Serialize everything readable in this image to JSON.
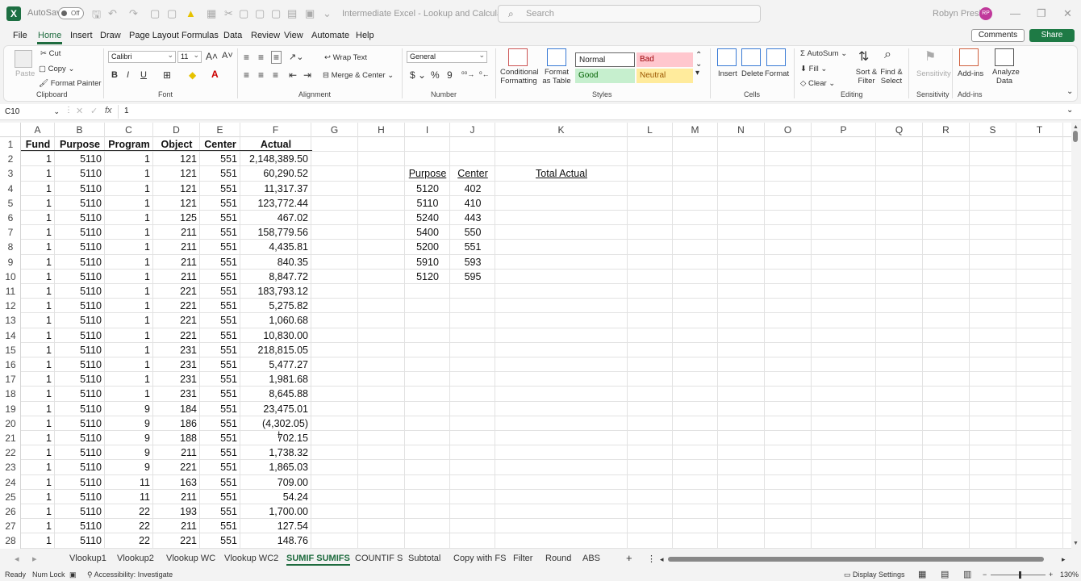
{
  "app": {
    "logo": "X",
    "autosave_label": "AutoSave",
    "autosave_state": "Off",
    "document_title": "Intermediate Excel - Lookup and Calculat...",
    "search_placeholder": "Search",
    "user_name": "Robyn Presley",
    "user_initials": "RP"
  },
  "menu": {
    "tabs": [
      "File",
      "Home",
      "Insert",
      "Draw",
      "Page Layout",
      "Formulas",
      "Data",
      "Review",
      "View",
      "Automate",
      "Help"
    ],
    "active": "Home",
    "comments_label": "Comments",
    "share_label": "Share"
  },
  "ribbon": {
    "clipboard": {
      "label": "Clipboard",
      "paste": "Paste",
      "cut": "Cut",
      "copy": "Copy",
      "format_painter": "Format Painter"
    },
    "font": {
      "label": "Font",
      "name": "Calibri",
      "size": "11",
      "bold": "B",
      "italic": "I",
      "underline": "U"
    },
    "alignment": {
      "label": "Alignment",
      "wrap_text": "Wrap Text",
      "merge_center": "Merge & Center"
    },
    "number": {
      "label": "Number",
      "format": "General",
      "currency": "$",
      "percent": "%",
      "comma": "9"
    },
    "styles": {
      "label": "Styles",
      "conditional_formatting": "Conditional Formatting",
      "format_as_table": "Format as Table",
      "normal": "Normal",
      "bad": "Bad",
      "good": "Good",
      "neutral": "Neutral"
    },
    "cells": {
      "label": "Cells",
      "insert": "Insert",
      "delete": "Delete",
      "format": "Format"
    },
    "editing": {
      "label": "Editing",
      "autosum": "AutoSum",
      "fill": "Fill",
      "clear": "Clear",
      "sort_filter": "Sort & Filter",
      "find_select": "Find & Select"
    },
    "sensitivity": {
      "label": "Sensitivity",
      "button": "Sensitivity"
    },
    "addins": {
      "label": "Add-ins",
      "button": "Add-ins",
      "analyze": "Analyze Data"
    }
  },
  "formula_bar": {
    "name_box": "C10",
    "fx": "fx",
    "value": "1"
  },
  "columns": [
    "A",
    "B",
    "C",
    "D",
    "E",
    "F",
    "G",
    "H",
    "I",
    "J",
    "K",
    "L",
    "M",
    "N",
    "O",
    "P",
    "Q",
    "R",
    "S",
    "T"
  ],
  "rows": [
    "1",
    "2",
    "3",
    "4",
    "5",
    "6",
    "7",
    "8",
    "9",
    "10",
    "11",
    "12",
    "13",
    "14",
    "15",
    "16",
    "17",
    "18",
    "19",
    "20",
    "21",
    "22",
    "23",
    "24",
    "25",
    "26",
    "27",
    "28"
  ],
  "table": {
    "headers": [
      "Fund",
      "Purpose",
      "Program",
      "Object",
      "Center",
      "Actual"
    ],
    "data": [
      [
        "1",
        "5110",
        "1",
        "121",
        "551",
        "2,148,389.50"
      ],
      [
        "1",
        "5110",
        "1",
        "121",
        "551",
        "60,290.52"
      ],
      [
        "1",
        "5110",
        "1",
        "121",
        "551",
        "11,317.37"
      ],
      [
        "1",
        "5110",
        "1",
        "121",
        "551",
        "123,772.44"
      ],
      [
        "1",
        "5110",
        "1",
        "125",
        "551",
        "467.02"
      ],
      [
        "1",
        "5110",
        "1",
        "211",
        "551",
        "158,779.56"
      ],
      [
        "1",
        "5110",
        "1",
        "211",
        "551",
        "4,435.81"
      ],
      [
        "1",
        "5110",
        "1",
        "211",
        "551",
        "840.35"
      ],
      [
        "1",
        "5110",
        "1",
        "211",
        "551",
        "8,847.72"
      ],
      [
        "1",
        "5110",
        "1",
        "221",
        "551",
        "183,793.12"
      ],
      [
        "1",
        "5110",
        "1",
        "221",
        "551",
        "5,275.82"
      ],
      [
        "1",
        "5110",
        "1",
        "221",
        "551",
        "1,060.68"
      ],
      [
        "1",
        "5110",
        "1",
        "221",
        "551",
        "10,830.00"
      ],
      [
        "1",
        "5110",
        "1",
        "231",
        "551",
        "218,815.05"
      ],
      [
        "1",
        "5110",
        "1",
        "231",
        "551",
        "5,477.27"
      ],
      [
        "1",
        "5110",
        "1",
        "231",
        "551",
        "1,981.68"
      ],
      [
        "1",
        "5110",
        "1",
        "231",
        "551",
        "8,645.88"
      ],
      [
        "1",
        "5110",
        "9",
        "184",
        "551",
        "23,475.01"
      ],
      [
        "1",
        "5110",
        "9",
        "186",
        "551",
        "(4,302.05)"
      ],
      [
        "1",
        "5110",
        "9",
        "188",
        "551",
        "702.15"
      ],
      [
        "1",
        "5110",
        "9",
        "211",
        "551",
        "1,738.32"
      ],
      [
        "1",
        "5110",
        "9",
        "221",
        "551",
        "1,865.03"
      ],
      [
        "1",
        "5110",
        "11",
        "163",
        "551",
        "709.00"
      ],
      [
        "1",
        "5110",
        "11",
        "211",
        "551",
        "54.24"
      ],
      [
        "1",
        "5110",
        "22",
        "193",
        "551",
        "1,700.00"
      ],
      [
        "1",
        "5110",
        "22",
        "211",
        "551",
        "127.54"
      ],
      [
        "1",
        "5110",
        "22",
        "221",
        "551",
        "148.76"
      ]
    ]
  },
  "lookup": {
    "headers": [
      "Purpose",
      "Center",
      "Total Actual"
    ],
    "rows": [
      [
        "5120",
        "402"
      ],
      [
        "5110",
        "410"
      ],
      [
        "5240",
        "443"
      ],
      [
        "5400",
        "550"
      ],
      [
        "5200",
        "551"
      ],
      [
        "5910",
        "593"
      ],
      [
        "5120",
        "595"
      ]
    ]
  },
  "sheets": [
    "Vlookup1",
    "Vlookup2",
    "Vlookup WC",
    "Vlookup WC2",
    "SUMIF SUMIFS",
    "COUNTIF S",
    "Subtotal",
    "Copy with FS",
    "Filter",
    "Round",
    "ABS"
  ],
  "active_sheet": "SUMIF SUMIFS",
  "status": {
    "ready": "Ready",
    "num_lock": "Num Lock",
    "accessibility": "Accessibility: Investigate",
    "display_settings": "Display Settings",
    "zoom": "130%"
  },
  "colors": {
    "accent": "#1e6b3e",
    "bad_bg": "#ffc7ce",
    "bad_fg": "#9c0006",
    "good_bg": "#c6efce",
    "good_fg": "#006100",
    "neutral_bg": "#ffeb9c",
    "neutral_fg": "#9c5700"
  }
}
